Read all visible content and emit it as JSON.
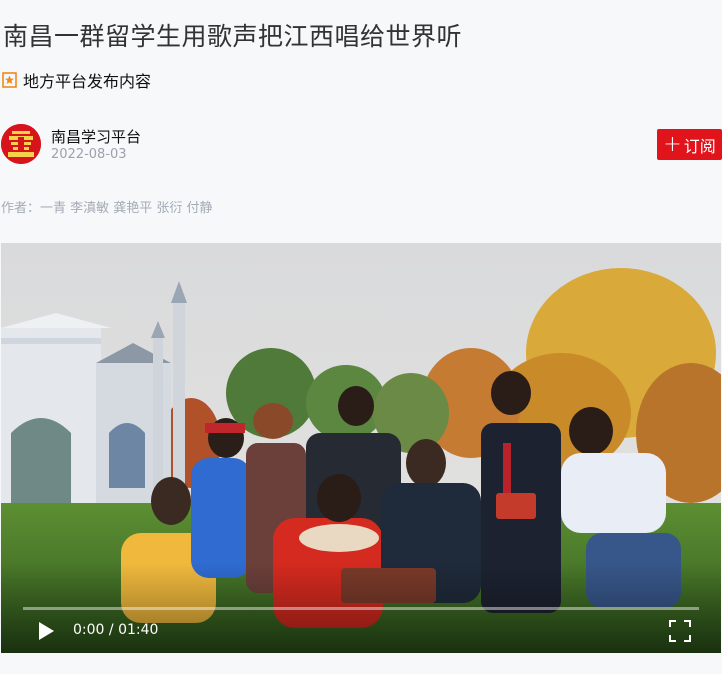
{
  "article": {
    "title": "南昌一群留学生用歌声把江西唱给世界听",
    "source_label": "地方平台发布内容",
    "source_icon": "ribbon-badge-icon",
    "platform_name": "南昌学习平台",
    "publish_date": "2022-08-03",
    "subscribe_label": "订阅",
    "byline": "作者：一青 李滇敏 龚艳平 张衍 付静"
  },
  "video": {
    "current_time": "0:00",
    "separator": " / ",
    "duration": "01:40",
    "progress": 0.0,
    "play_icon": "play-icon",
    "fullscreen_icon": "fullscreen-icon"
  },
  "colors": {
    "accent_red": "#e1141b",
    "muted_text": "#a4abb6",
    "background": "#f7f8fa"
  }
}
